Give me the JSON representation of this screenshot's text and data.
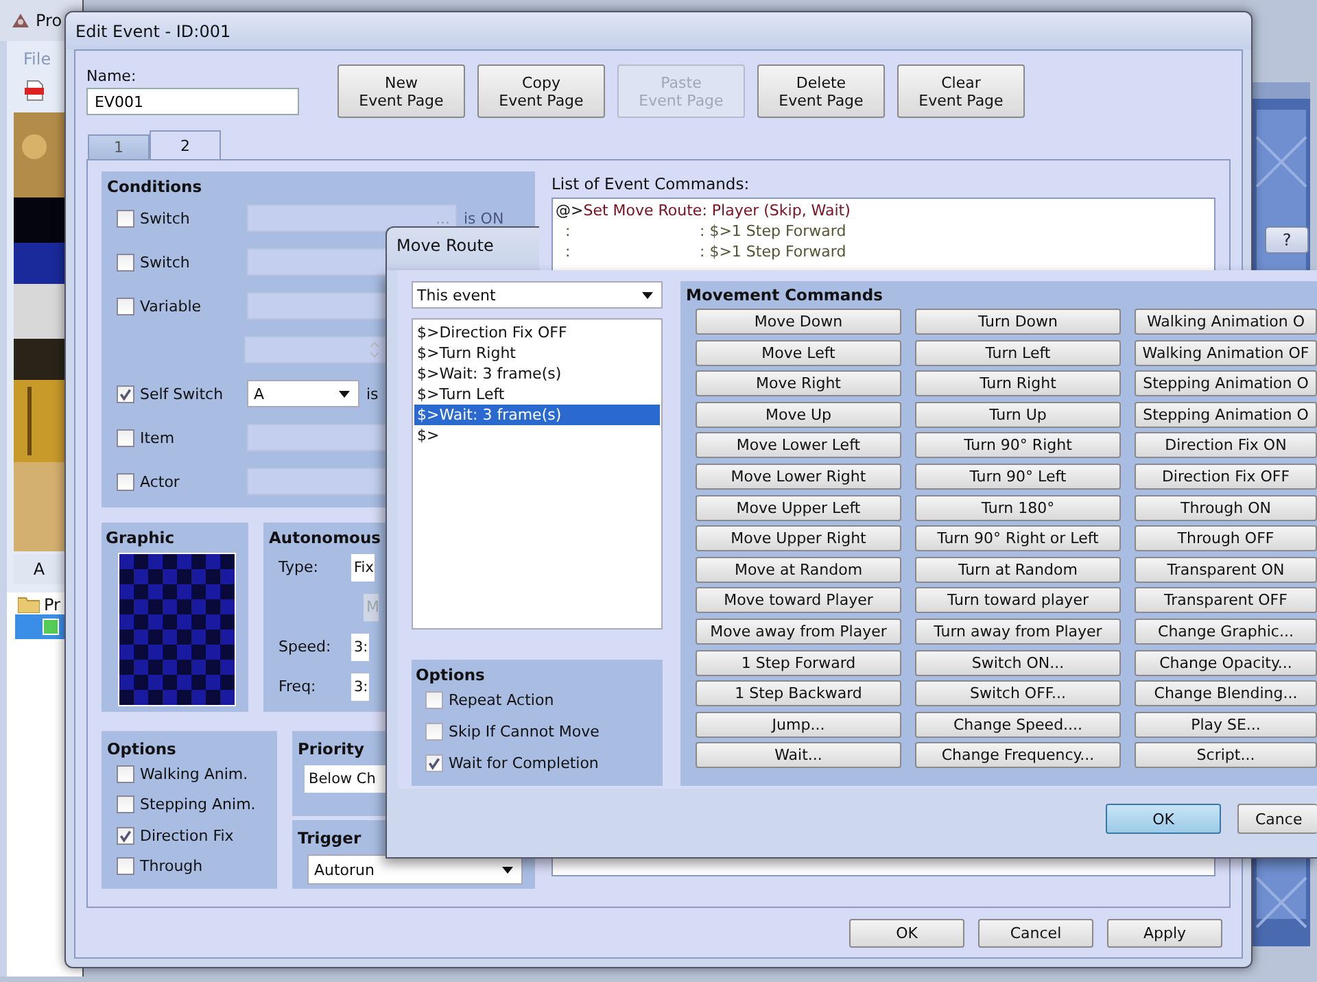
{
  "background_app": {
    "title": "Pro",
    "menu": "File",
    "tab": "A",
    "tree_label": "Pr"
  },
  "edit_event": {
    "title": "Edit Event - ID:001",
    "name_label": "Name:",
    "name_value": "EV001",
    "page_buttons": [
      {
        "label": "New\nEvent Page",
        "disabled": false
      },
      {
        "label": "Copy\nEvent Page",
        "disabled": false
      },
      {
        "label": "Paste\nEvent Page",
        "disabled": true
      },
      {
        "label": "Delete\nEvent Page",
        "disabled": false
      },
      {
        "label": "Clear\nEvent Page",
        "disabled": false
      }
    ],
    "tabs": [
      {
        "label": "1",
        "selected": false
      },
      {
        "label": "2",
        "selected": true
      }
    ],
    "conditions": {
      "title": "Conditions",
      "rows": [
        {
          "kind": "switch",
          "label": "Switch",
          "checked": false,
          "field_button": "...",
          "suffix": "is ON"
        },
        {
          "kind": "field",
          "label": "Switch",
          "checked": false
        },
        {
          "kind": "field",
          "label": "Variable",
          "checked": false
        },
        {
          "kind": "spinner"
        },
        {
          "kind": "dropdown",
          "label": "Self Switch",
          "checked": true,
          "value": "A",
          "suffix": "is"
        },
        {
          "kind": "field",
          "label": "Item",
          "checked": false
        },
        {
          "kind": "field",
          "label": "Actor",
          "checked": false
        }
      ]
    },
    "graphic": {
      "title": "Graphic"
    },
    "autonomous": {
      "title": "Autonomous",
      "type_label": "Type:",
      "type_value": "Fix",
      "move_button": "M",
      "speed_label": "Speed:",
      "speed_value": "3:",
      "freq_label": "Freq:",
      "freq_value": "3:"
    },
    "options": {
      "title": "Options",
      "items": [
        {
          "label": "Walking Anim.",
          "checked": false
        },
        {
          "label": "Stepping Anim.",
          "checked": false
        },
        {
          "label": "Direction Fix",
          "checked": true
        },
        {
          "label": "Through",
          "checked": false
        }
      ]
    },
    "priority": {
      "title": "Priority",
      "value": "Below Ch"
    },
    "trigger": {
      "title": "Trigger",
      "value": "Autorun"
    },
    "commands": {
      "title": "List of Event Commands:",
      "rows": [
        {
          "kind": "route",
          "marker": "@>",
          "text": "Set Move Route: Player (Skip, Wait)"
        },
        {
          "kind": "step",
          "marker": ":",
          "text": ": $>1 Step Forward"
        },
        {
          "kind": "step",
          "marker": ":",
          "text": ": $>1 Step Forward"
        }
      ]
    },
    "footer_buttons": [
      "OK",
      "Cancel",
      "Apply"
    ]
  },
  "move_route": {
    "title": "Move Route",
    "help": "?",
    "target": "This event",
    "route": [
      {
        "text": "$>Direction Fix OFF",
        "selected": false
      },
      {
        "text": "$>Turn Right",
        "selected": false
      },
      {
        "text": "$>Wait: 3 frame(s)",
        "selected": false
      },
      {
        "text": "$>Turn Left",
        "selected": false
      },
      {
        "text": "$>Wait: 3 frame(s)",
        "selected": true
      },
      {
        "text": "$>",
        "selected": false
      }
    ],
    "options": {
      "title": "Options",
      "items": [
        {
          "label": "Repeat Action",
          "checked": false
        },
        {
          "label": "Skip If Cannot Move",
          "checked": false
        },
        {
          "label": "Wait for Completion",
          "checked": true
        }
      ]
    },
    "commands_title": "Movement Commands",
    "command_columns": [
      [
        "Move Down",
        "Move Left",
        "Move Right",
        "Move Up",
        "Move Lower Left",
        "Move Lower Right",
        "Move Upper Left",
        "Move Upper Right",
        "Move at Random",
        "Move toward Player",
        "Move away from Player",
        "1 Step Forward",
        "1 Step Backward",
        "Jump...",
        "Wait..."
      ],
      [
        "Turn Down",
        "Turn Left",
        "Turn Right",
        "Turn Up",
        "Turn 90° Right",
        "Turn 90° Left",
        "Turn 180°",
        "Turn 90° Right or Left",
        "Turn at Random",
        "Turn toward player",
        "Turn away from Player",
        "Switch ON...",
        "Switch OFF...",
        "Change Speed....",
        "Change Frequency..."
      ],
      [
        "Walking Animation O",
        "Walking Animation OF",
        "Stepping Animation O",
        "Stepping Animation O",
        "Direction Fix ON",
        "Direction Fix OFF",
        "Through ON",
        "Through OFF",
        "Transparent ON",
        "Transparent OFF",
        "Change Graphic...",
        "Change Opacity...",
        "Change Blending...",
        "Play SE...",
        "Script..."
      ]
    ],
    "ok": "OK",
    "cancel": "Cance"
  }
}
